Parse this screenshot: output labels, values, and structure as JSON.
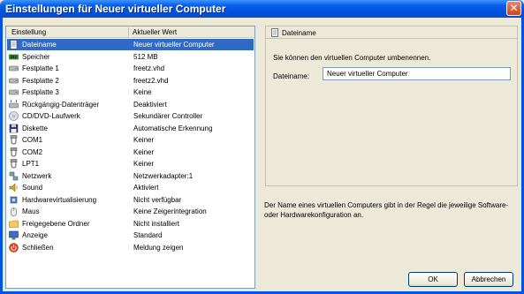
{
  "window": {
    "title": "Einstellungen für Neuer virtueller Computer",
    "close_label": "✕"
  },
  "list": {
    "headers": [
      "Einstellung",
      "Aktueller Wert"
    ],
    "rows": [
      {
        "name": "Dateiname",
        "value": "Neuer virtueller Computer",
        "icon": "document-icon",
        "selected": true
      },
      {
        "name": "Speicher",
        "value": "512 MB",
        "icon": "memory-icon"
      },
      {
        "name": "Festplatte 1",
        "value": "freetz.vhd",
        "icon": "harddisk-icon"
      },
      {
        "name": "Festplatte 2",
        "value": "freetz2.vhd",
        "icon": "harddisk-icon"
      },
      {
        "name": "Festplatte 3",
        "value": "Keine",
        "icon": "harddisk-icon"
      },
      {
        "name": "Rückgängig-Datenträger",
        "value": "Deaktiviert",
        "icon": "undo-disk-icon"
      },
      {
        "name": "CD/DVD-Laufwerk",
        "value": "Sekundärer Controller",
        "icon": "cd-icon"
      },
      {
        "name": "Diskette",
        "value": "Automatische Erkennung",
        "icon": "floppy-icon"
      },
      {
        "name": "COM1",
        "value": "Keiner",
        "icon": "port-icon"
      },
      {
        "name": "COM2",
        "value": "Keiner",
        "icon": "port-icon"
      },
      {
        "name": "LPT1",
        "value": "Keiner",
        "icon": "port-icon"
      },
      {
        "name": "Netzwerk",
        "value": "Netzwerkadapter:1",
        "icon": "network-icon"
      },
      {
        "name": "Sound",
        "value": "Aktiviert",
        "icon": "sound-icon"
      },
      {
        "name": "Hardwarevirtualisierung",
        "value": "Nicht verfügbar",
        "icon": "chip-icon"
      },
      {
        "name": "Maus",
        "value": "Keine Zeigerintegration",
        "icon": "mouse-icon"
      },
      {
        "name": "Freigegebene Ordner",
        "value": "Nicht installiert",
        "icon": "folder-icon"
      },
      {
        "name": "Anzeige",
        "value": "Standard",
        "icon": "display-icon"
      },
      {
        "name": "Schließen",
        "value": "Meldung zeigen",
        "icon": "close-app-icon"
      }
    ]
  },
  "detail": {
    "header": "Dateiname",
    "description": "Sie können den virtuellen Computer umbenennen.",
    "field_label": "Dateiname:",
    "field_value": "Neuer virtueller Computer"
  },
  "info": "Der Name eines virtuellen Computers gibt in der Regel die jeweilige Software- oder Hardwarekonfiguration an.",
  "buttons": {
    "ok": "OK",
    "cancel": "Abbrechen"
  }
}
